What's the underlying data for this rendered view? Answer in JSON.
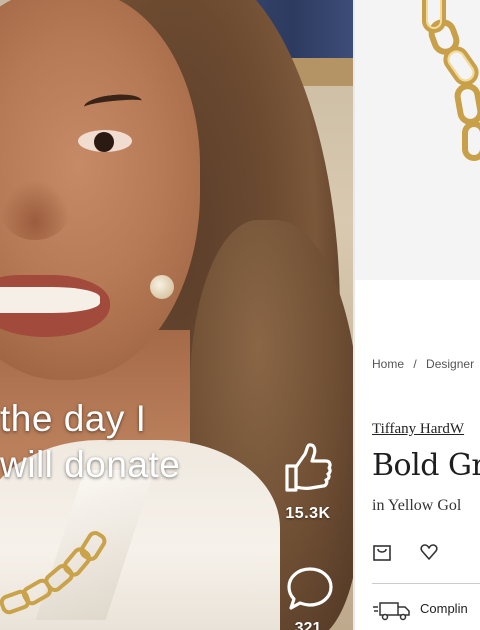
{
  "video": {
    "caption_line1": "the day I",
    "caption_line2": "will donate",
    "like_count": "15.3K",
    "comment_count": "321"
  },
  "product": {
    "breadcrumb": [
      "Home",
      "/",
      "Designer"
    ],
    "brand": "Tiffany HardW",
    "title": "Bold Gr",
    "subtitle": "in Yellow Gol",
    "shipping": "Complin"
  },
  "icons": {
    "like": "thumbs-up-icon",
    "comment": "speech-bubble-icon",
    "bag": "shopping-bag-icon",
    "heart": "heart-icon",
    "truck": "delivery-truck-icon"
  }
}
